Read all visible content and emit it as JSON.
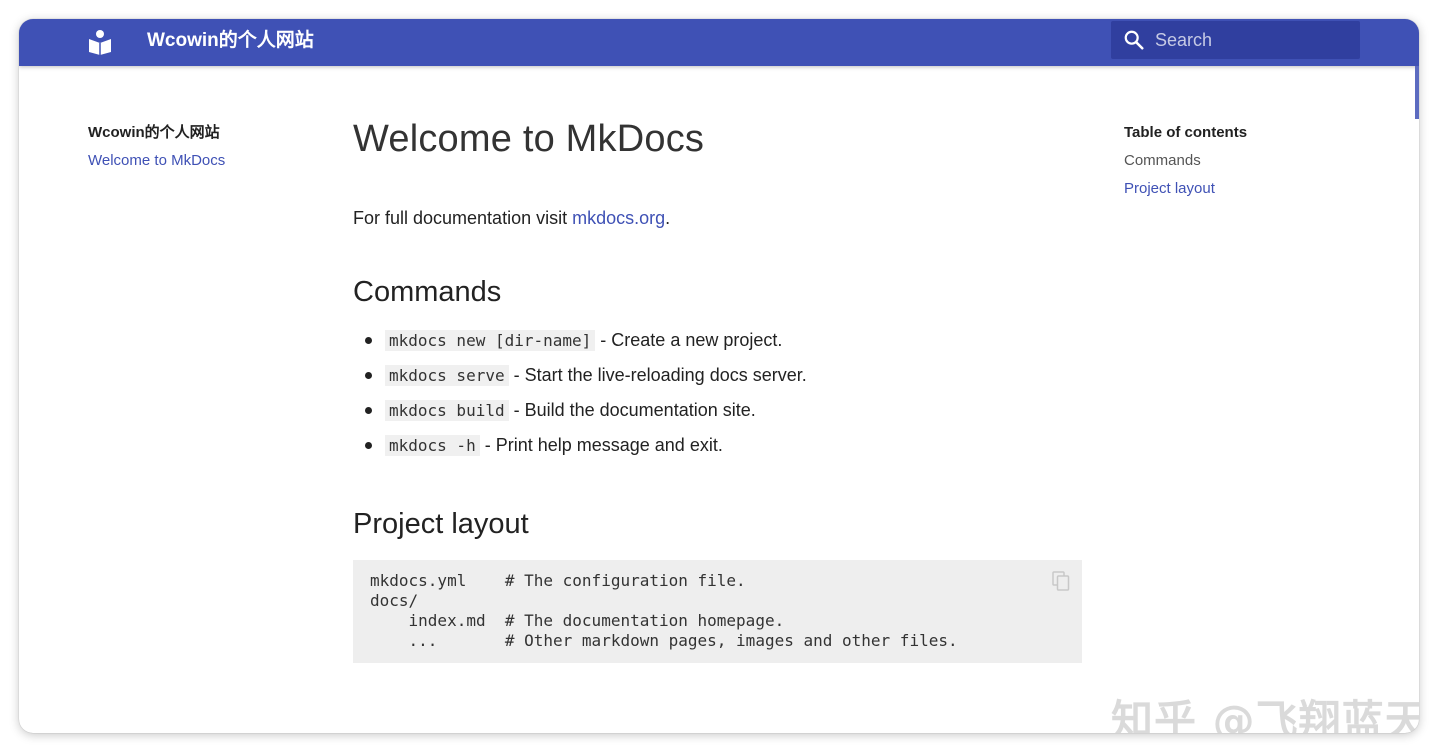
{
  "header": {
    "site_title": "Wcowin的个人网站",
    "search_placeholder": "Search",
    "brand_color": "#3f51b5"
  },
  "nav": {
    "title": "Wcowin的个人网站",
    "items": [
      {
        "label": "Welcome to MkDocs"
      }
    ]
  },
  "toc": {
    "title": "Table of contents",
    "items": [
      {
        "label": "Commands"
      },
      {
        "label": "Project layout"
      }
    ]
  },
  "content": {
    "title": "Welcome to MkDocs",
    "intro_prefix": "For full documentation visit ",
    "intro_link": "mkdocs.org",
    "intro_suffix": ".",
    "commands_heading": "Commands",
    "commands": [
      {
        "code": "mkdocs new [dir-name]",
        "desc": " - Create a new project."
      },
      {
        "code": "mkdocs serve",
        "desc": " - Start the live-reloading docs server."
      },
      {
        "code": "mkdocs build",
        "desc": " - Build the documentation site."
      },
      {
        "code": "mkdocs -h",
        "desc": " - Print help message and exit."
      }
    ],
    "layout_heading": "Project layout",
    "layout_code": "mkdocs.yml    # The configuration file.\ndocs/\n    index.md  # The documentation homepage.\n    ...       # Other markdown pages, images and other files."
  },
  "watermark": "知乎 @飞翔蓝天"
}
